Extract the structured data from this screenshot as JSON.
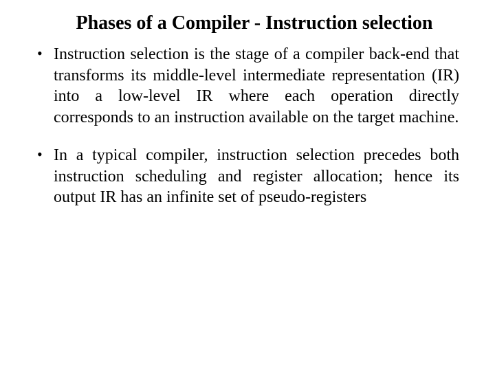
{
  "title": "Phases of a Compiler - Instruction selection",
  "bullets": {
    "item0": "Instruction selection is the stage of a compiler back-end that transforms its middle-level intermediate representation (IR) into a low-level IR where each operation directly corresponds to an instruction available on the target machine.",
    "item1": "In a typical compiler, instruction selection precedes both instruction scheduling and register allocation; hence its output IR has an infinite set of pseudo-registers"
  }
}
